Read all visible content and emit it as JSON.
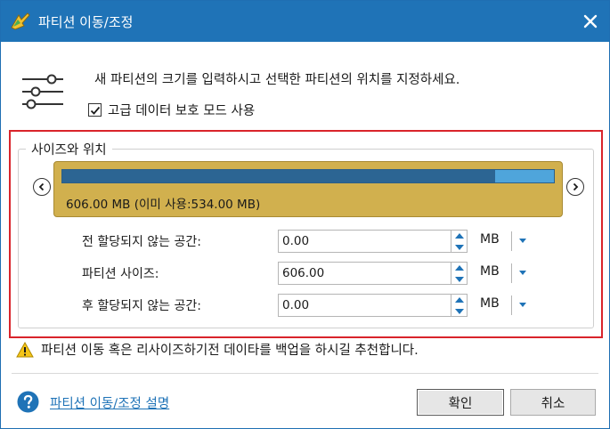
{
  "window": {
    "title": "파티션 이동/조정",
    "accent_color": "#1f73b7"
  },
  "header": {
    "instruction": "새 파티션의 크기를 입력하시고 선택한 파티션의 위치를 지정하세요.",
    "advanced_mode_label": "고급 데이터 보호 모드 사용",
    "advanced_mode_checked": true
  },
  "size_position": {
    "legend": "사이즈와 위치",
    "partition_text": "606.00 MB (이미 사용:534.00 MB)",
    "used_fraction": 0.881,
    "block_color": "#d1b04e",
    "used_color": "#2c6593",
    "free_color": "#4fa5db"
  },
  "fields": [
    {
      "label": "전 할당되지 않는 공간:",
      "value": "0.00",
      "unit": "MB"
    },
    {
      "label": "파티션 사이즈:",
      "value": "606.00",
      "unit": "MB"
    },
    {
      "label": "후 할당되지 않는 공간:",
      "value": "0.00",
      "unit": "MB"
    }
  ],
  "warning": "파티션 이동 혹은 리사이즈하기전 데이타를 백업을 하시길 추천합니다.",
  "footer": {
    "help_link": "파티션 이동/조정 설명",
    "ok_label": "확인",
    "cancel_label": "취소"
  },
  "icons": {
    "app": "move-resize-app-icon",
    "close": "close-icon",
    "settings": "sliders-icon",
    "warning": "warning-icon",
    "help": "help-icon"
  }
}
